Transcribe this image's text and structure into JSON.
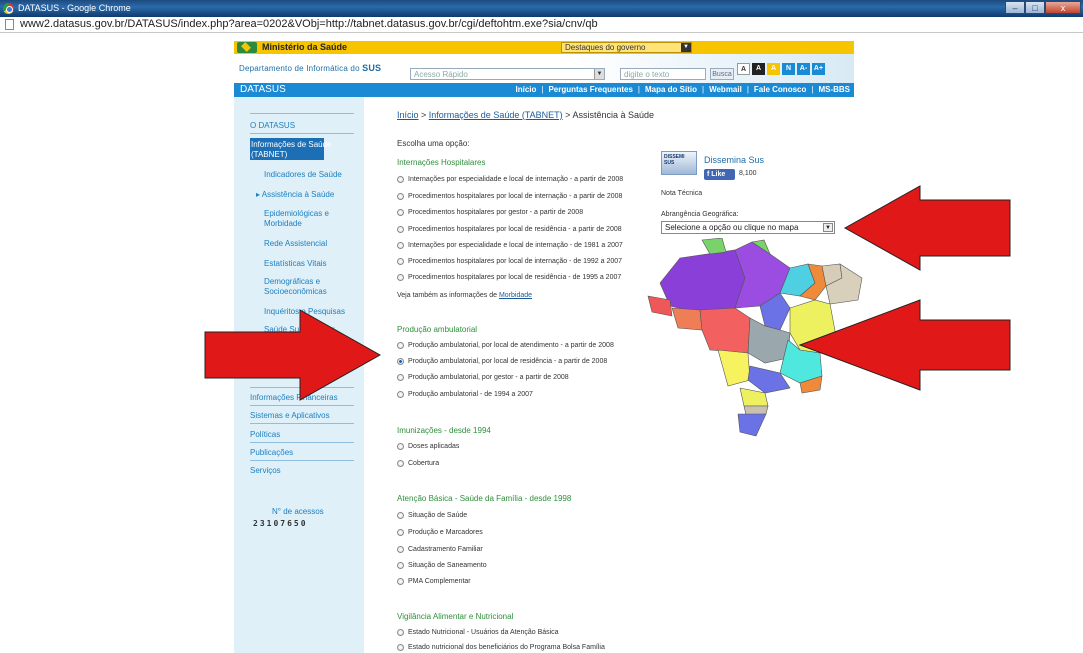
{
  "window": {
    "title": "DATASUS - Google Chrome",
    "url": "www2.datasus.gov.br/DATASUS/index.php?area=0202&VObj=http://tabnet.datasus.gov.br/cgi/deftohtm.exe?sia/cnv/qb",
    "buttons": {
      "minimize": "–",
      "maximize": "□",
      "close": "x"
    }
  },
  "gov_bar": {
    "ministry": "Ministério da Saúde",
    "highlights": "Destaques do governo"
  },
  "header": {
    "dept_prefix": "Departamento de Informática do ",
    "dept_sus": "SUS",
    "quick_access": "Acesso Rápido",
    "search_placeholder": "digite o texto",
    "search_button": "Busca",
    "access_buttons": [
      "A",
      "A",
      "A",
      "N",
      "A-",
      "A+"
    ]
  },
  "nav": {
    "brand": "DATASUS",
    "links": [
      "Início",
      "Perguntas Frequentes",
      "Mapa do Sítio",
      "Webmail",
      "Fale Conosco",
      "MS-BBS"
    ]
  },
  "sidebar": {
    "items": [
      "O DATASUS",
      "Informações de Saúde",
      "(TABNET)",
      "Indicadores de Saúde",
      "▸ Assistência à Saúde",
      "Epidemiológicas e",
      "Morbidade",
      "Rede Assistencial",
      "Estatísticas Vitais",
      "Demográficas e",
      "Socioeconômicas",
      "Inquéritos e Pesquisas",
      "Saúde Suplementar",
      "Informações Financeiras",
      "Sistemas e Aplicativos",
      "Políticas",
      "Publicações",
      "Serviços"
    ],
    "counter_label": "N° de acessos",
    "counter_value": "23107650"
  },
  "main": {
    "breadcrumb": {
      "home": "Início",
      "sep": " > ",
      "section": "Informações de Saúde (TABNET)",
      "current": "Assistência à Saúde"
    },
    "choose": "Escolha uma opção:",
    "sections": [
      {
        "title": "Internações Hospitalares",
        "options": [
          "Internações por especialidade e local de internação - a partir de 2008",
          "Procedimentos hospitalares por local de internação - a partir de 2008",
          "Procedimentos hospitalares por gestor - a partir de 2008",
          "Procedimentos hospitalares por local de residência - a partir de 2008",
          "Internações por especialidade e local de internação - de 1981 a 2007",
          "Procedimentos hospitalares por local de internação - de 1992 a 2007",
          "Procedimentos hospitalares por local de residência - de 1995 a 2007"
        ]
      },
      {
        "title": "Produção ambulatorial",
        "options": [
          "Produção ambulatorial, por local de atendimento - a partir de 2008",
          "Produção ambulatorial, por local de residência - a partir de 2008",
          "Produção ambulatorial, por gestor - a partir de 2008",
          "Produção ambulatorial - de 1994 a 2007"
        ],
        "selected": 1
      },
      {
        "title": "Imunizações - desde 1994",
        "options": [
          "Doses aplicadas",
          "Cobertura"
        ]
      },
      {
        "title": "Atenção Básica - Saúde da Família - desde 1998",
        "options": [
          "Situação de Saúde",
          "Produção e Marcadores",
          "Cadastramento Familiar",
          "Situação de Saneamento",
          "PMA Complementar"
        ]
      },
      {
        "title": "Vigilância Alimentar e Nutricional",
        "options": [
          "Estado Nutricional - Usuários da Atenção Básica",
          "Estado nutricional dos beneficiários do Programa Bolsa Família"
        ]
      }
    ],
    "see_also_prefix": "Veja também as informações de ",
    "see_also_link": "Morbidade"
  },
  "right": {
    "logo_text": "DISSEMI SUS",
    "dissemina": "Dissemina Sus",
    "like": "Like",
    "like_count": "8,100",
    "nota": "Nota Técnica",
    "abrangencia_label": "Abrangência Geográfica:",
    "abrangencia_value": "Selecione a opção ou clique no mapa"
  },
  "colors": {
    "arrow": "#e01818",
    "nav": "#1b8ad4",
    "sidebar": "#dff0f9",
    "gov": "#f7c400",
    "section_title": "#2e8f3a"
  }
}
